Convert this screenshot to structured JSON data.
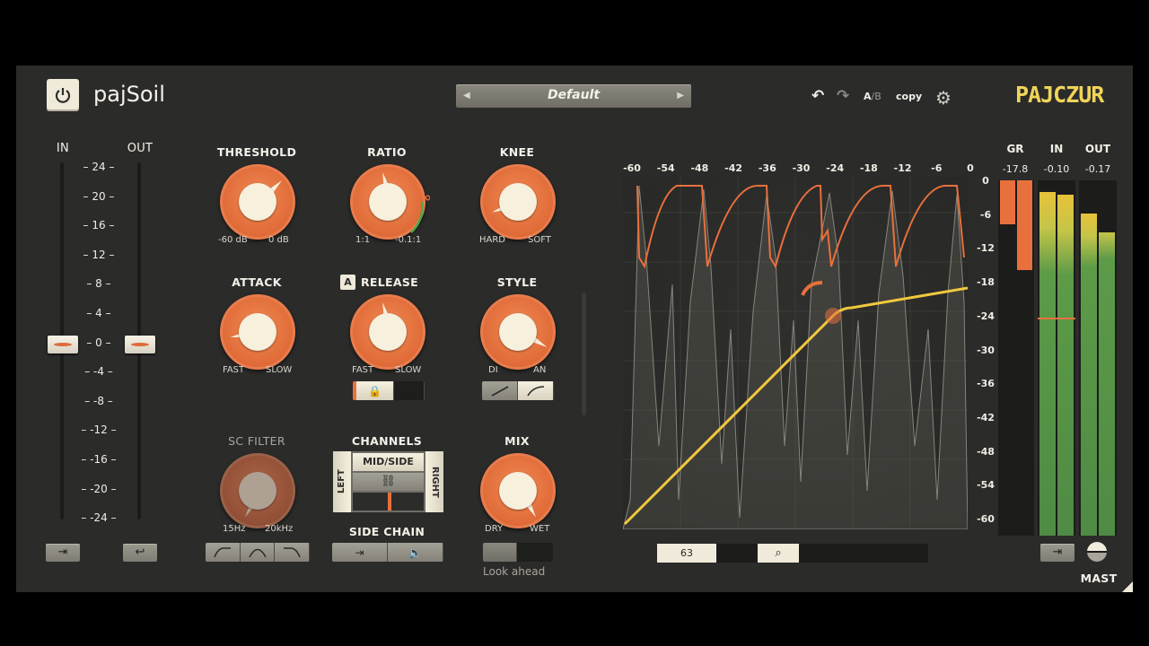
{
  "header": {
    "plugin_name": "pajSoil",
    "preset_name": "Default",
    "ab_a": "A",
    "ab_b": "/B",
    "copy_label": "copy",
    "brand": "PAJCZUR",
    "accent_color": "#e8703d",
    "brand_color": "#f0d45a"
  },
  "io": {
    "in_label": "IN",
    "out_label": "OUT",
    "scale": [
      "24",
      "20",
      "16",
      "12",
      "8",
      "4",
      "0",
      "-4",
      "-8",
      "-12",
      "-16",
      "-20",
      "-24"
    ],
    "in_value_db": 0,
    "out_value_db": 0
  },
  "knobs": {
    "threshold": {
      "label": "THRESHOLD",
      "min": "-60 dB",
      "max": "0 dB"
    },
    "ratio": {
      "label": "RATIO",
      "min": "1:1",
      "max": "-0.1:1",
      "inf": "∞"
    },
    "knee": {
      "label": "KNEE",
      "min": "HARD",
      "max": "SOFT"
    },
    "attack": {
      "label": "ATTACK",
      "min": "FAST",
      "max": "SLOW"
    },
    "release": {
      "label": "RELEASE",
      "auto": "A",
      "min": "FAST",
      "max": "SLOW"
    },
    "style": {
      "label": "STYLE",
      "min": "DI",
      "max": "AN"
    },
    "sc_filter": {
      "label": "SC FILTER",
      "min": "15Hz",
      "max": "20kHz"
    },
    "mix": {
      "label": "MIX",
      "min": "DRY",
      "max": "WET"
    }
  },
  "channels": {
    "label": "CHANNELS",
    "mid_side": "MID/SIDE",
    "left": "LEFT",
    "right": "RIGHT"
  },
  "side_chain": {
    "label": "SIDE CHAIN"
  },
  "lookahead": {
    "label": "Look ahead"
  },
  "graph": {
    "top_scale": [
      "-60",
      "-54",
      "-48",
      "-42",
      "-36",
      "-30",
      "-24",
      "-18",
      "-12",
      "-6",
      "0"
    ],
    "right_scale": [
      "0",
      "-6",
      "-12",
      "-18",
      "-24",
      "-30",
      "-36",
      "-42",
      "-48",
      "-54",
      "-60"
    ],
    "zoom_value": "63"
  },
  "meters": {
    "gr": {
      "label": "GR",
      "value": "-17.8"
    },
    "in": {
      "label": "IN",
      "value": "-0.10"
    },
    "out": {
      "label": "OUT",
      "value": "-0.17"
    },
    "mast_label": "MAST"
  }
}
